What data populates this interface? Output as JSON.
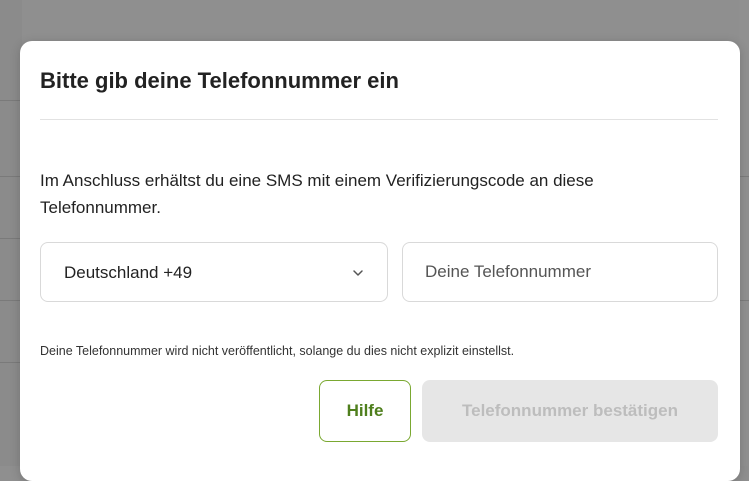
{
  "modal": {
    "title": "Bitte gib deine Telefonnummer ein",
    "description": "Im Anschluss erhältst du eine SMS mit einem Verifizierungscode an diese Telefonnummer.",
    "country_select": {
      "value": "Deutschland +49",
      "icon": "chevron-down-icon"
    },
    "phone_input": {
      "value": "",
      "placeholder": "Deine Telefonnummer"
    },
    "hint": "Deine Telefonnummer wird nicht veröffentlicht, solange du dies nicht explizit einstellst.",
    "buttons": {
      "help_label": "Hilfe",
      "confirm_label": "Telefonnummer bestätigen",
      "confirm_disabled": true
    }
  },
  "colors": {
    "accent_green": "#7aa831",
    "accent_green_text": "#4f7f1d",
    "disabled_bg": "#e6e6e6",
    "disabled_text": "#bdbdbd",
    "backdrop": "#8f8f8f"
  }
}
